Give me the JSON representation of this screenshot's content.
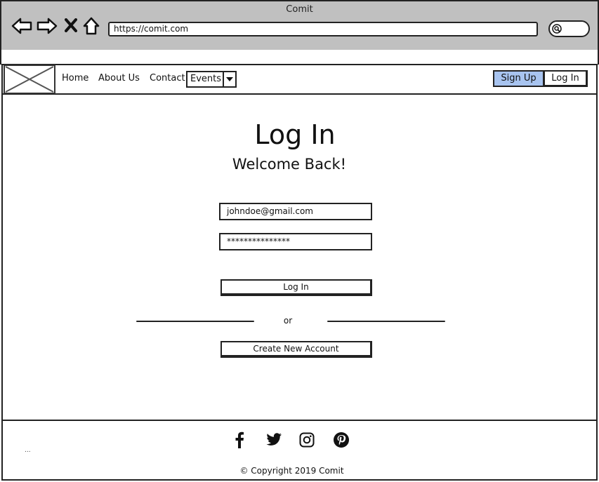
{
  "browser": {
    "window_title": "Comit",
    "url": "https://comit.com",
    "icons": [
      "back-arrow-icon",
      "forward-arrow-icon",
      "close-x-icon",
      "home-icon",
      "search-icon"
    ]
  },
  "nav": {
    "logo": "image-placeholder-icon",
    "links": [
      "Home",
      "About Us",
      "Contact"
    ],
    "events_dropdown": {
      "selected": "Events",
      "icon": "caret-down-icon"
    },
    "sign_up_label": "Sign Up",
    "log_in_label": "Log In",
    "accent_color": "#a8c4f0"
  },
  "main": {
    "title": "Log In",
    "subtitle": "Welcome Back!",
    "email_value": "johndoe@gmail.com",
    "password_value": "***************",
    "login_button_label": "Log In",
    "or_text": "or",
    "create_account_label": "Create New Account"
  },
  "footer": {
    "social_icons": [
      "facebook-icon",
      "twitter-icon",
      "instagram-icon",
      "pinterest-icon"
    ],
    "copyright": "© Copyright 2019 Comit",
    "ellipsis": "..."
  }
}
